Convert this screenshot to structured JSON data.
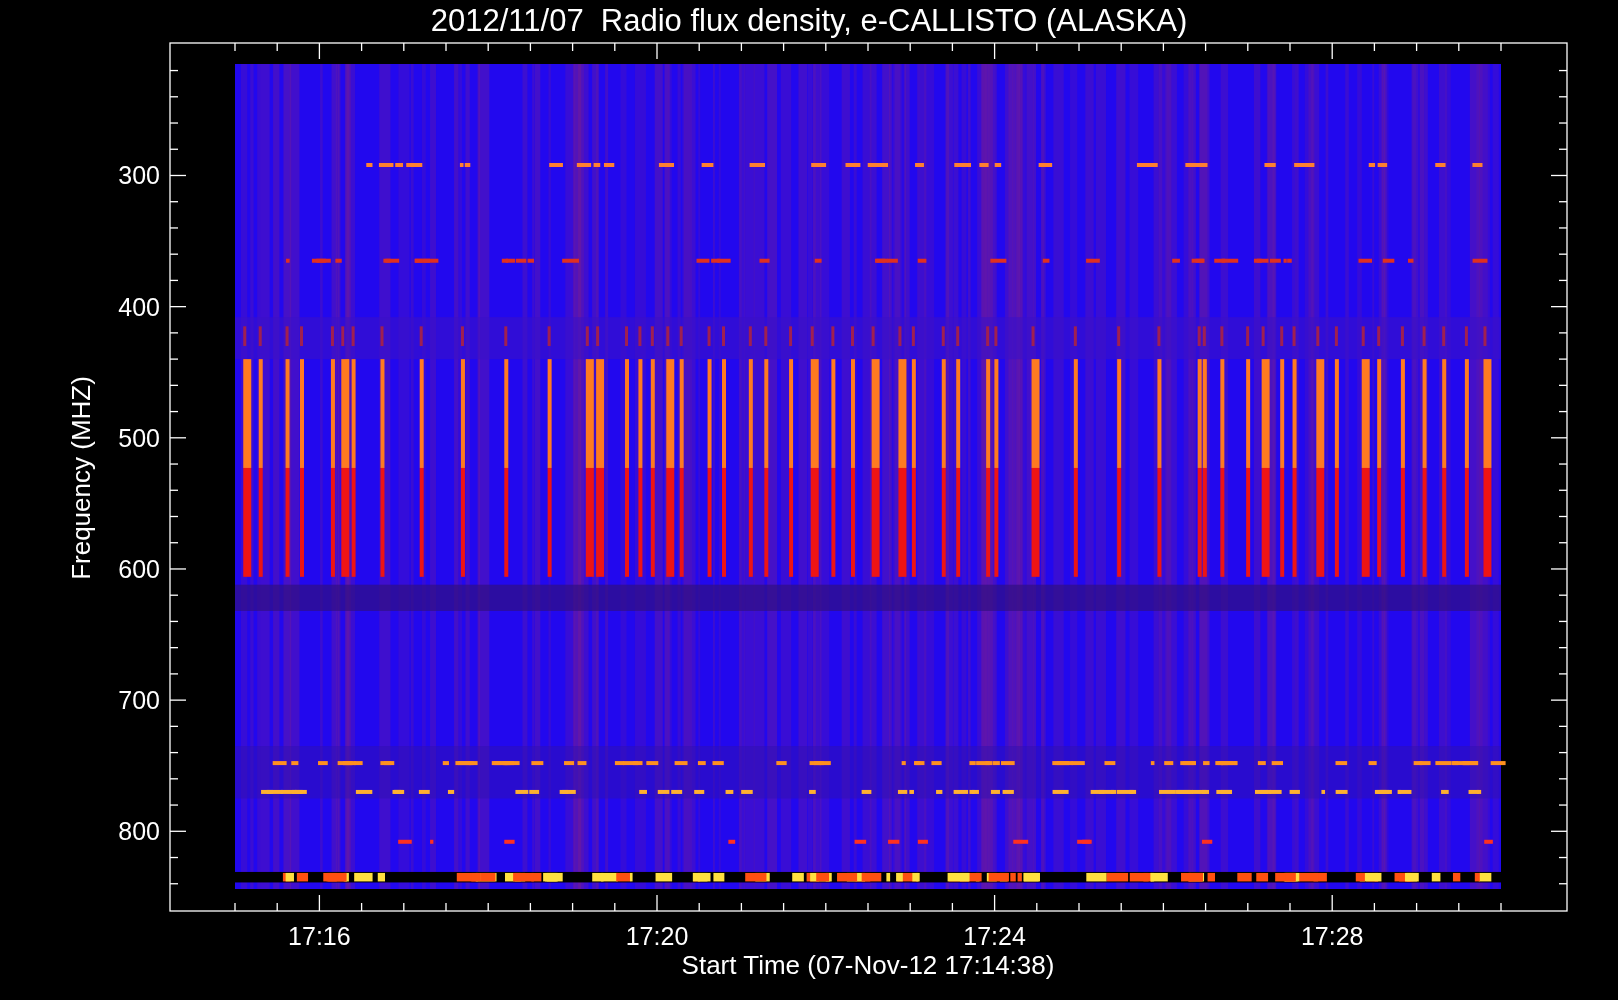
{
  "title": "2012/11/07  Radio flux density, e-CALLISTO (ALASKA)",
  "y_axis": {
    "label": "Frequency (MHZ)",
    "ticks": [
      "300",
      "400",
      "500",
      "600",
      "700",
      "800"
    ]
  },
  "x_axis": {
    "label": "Start Time (07-Nov-12 17:14:38)",
    "ticks": [
      "17:16",
      "17:20",
      "17:24",
      "17:28"
    ]
  }
}
